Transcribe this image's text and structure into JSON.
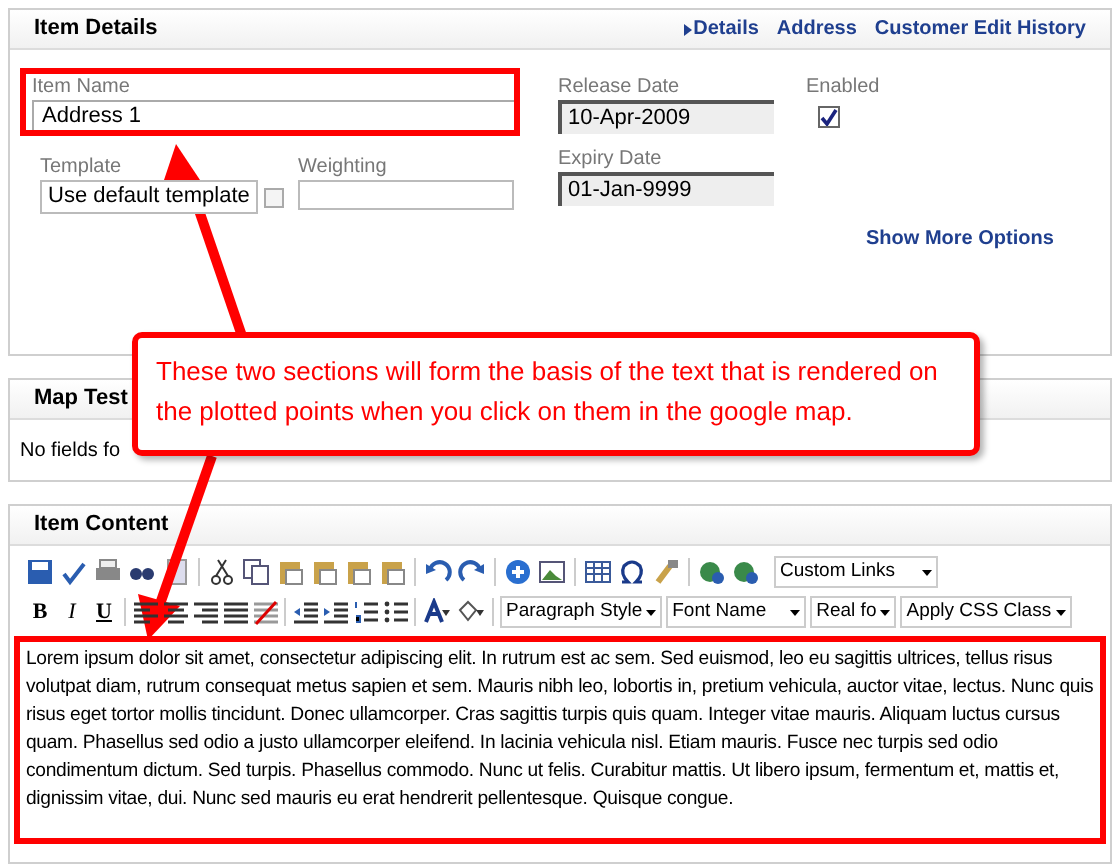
{
  "item_details": {
    "title": "Item Details",
    "links": [
      {
        "label": "Details",
        "current": true
      },
      {
        "label": "Address",
        "current": false
      },
      {
        "label": "Customer Edit History",
        "current": false
      }
    ],
    "item_name": {
      "label": "Item Name",
      "value": "Address 1"
    },
    "release_date": {
      "label": "Release Date",
      "value": "10-Apr-2009"
    },
    "enabled": {
      "label": "Enabled",
      "checked": true
    },
    "template": {
      "label": "Template",
      "value": "Use default template",
      "option_checked": false
    },
    "weighting": {
      "label": "Weighting"
    },
    "expiry_date": {
      "label": "Expiry Date",
      "value": "01-Jan-9999"
    },
    "more_options": "Show More Options"
  },
  "map_test": {
    "title": "Map Test",
    "message": "No fields fo"
  },
  "item_content": {
    "title": "Item Content",
    "format_buttons": [
      "B",
      "I",
      "U"
    ],
    "dropdowns_row1": [
      "Custom Links"
    ],
    "dropdowns_row2": [
      "Paragraph Style",
      "Font Name",
      "Real fo",
      "Apply CSS Class"
    ],
    "body": "Lorem ipsum dolor sit amet, consectetur adipiscing elit. In rutrum est ac sem. Sed euismod, leo eu sagittis ultrices, tellus risus volutpat diam, rutrum consequat metus sapien et sem. Mauris nibh leo, lobortis in, pretium vehicula, auctor vitae, lectus. Nunc quis risus eget tortor mollis tincidunt. Donec ullamcorper. Cras sagittis turpis quis quam. Integer vitae mauris. Aliquam luctus cursus quam. Phasellus sed odio a justo ullamcorper eleifend. In lacinia vehicula nisl. Etiam mauris. Fusce nec turpis sed odio condimentum dictum. Sed turpis. Phasellus commodo. Nunc ut felis. Curabitur mattis. Ut libero ipsum, fermentum et, mattis et, dignissim vitae, dui. Nunc sed mauris eu erat hendrerit pellentesque. Quisque congue."
  },
  "callout": "These two sections will form the basis of the text that is rendered on the plotted points when you click on them in the google map."
}
